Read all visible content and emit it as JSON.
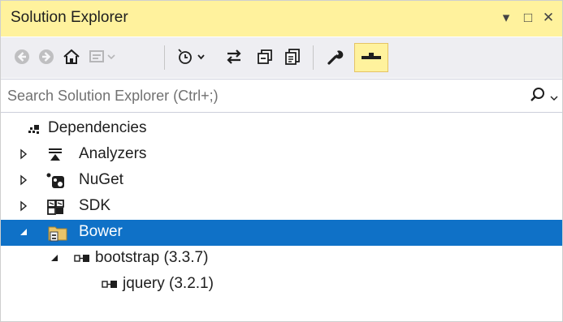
{
  "window": {
    "title": "Solution Explorer",
    "controls": {
      "menu": "▾",
      "maximize": "□",
      "close": "✕"
    }
  },
  "toolbar": {
    "icons": [
      "back-icon",
      "forward-icon",
      "home-icon",
      "switch-views-icon",
      "pending-changes-filter-icon",
      "sync-with-active-document-icon",
      "collapse-all-icon",
      "show-all-files-icon",
      "properties-icon",
      "preview-selected-items-icon"
    ]
  },
  "search": {
    "placeholder": "Search Solution Explorer (Ctrl+;)",
    "icon": "search-icon"
  },
  "tree": {
    "items": [
      {
        "label": "Dependencies",
        "level": 0,
        "expander": "none",
        "icon": "dependencies-icon"
      },
      {
        "label": "Analyzers",
        "level": 1,
        "expander": "collapsed",
        "icon": "analyzers-icon"
      },
      {
        "label": "NuGet",
        "level": 1,
        "expander": "collapsed",
        "icon": "nuget-icon"
      },
      {
        "label": "SDK",
        "level": 1,
        "expander": "collapsed",
        "icon": "sdk-icon"
      },
      {
        "label": "Bower",
        "level": 1,
        "expander": "expanded",
        "icon": "bower-folder-icon",
        "selected": true
      },
      {
        "label": "bootstrap (3.3.7)",
        "level": 2,
        "expander": "expanded",
        "icon": "package-icon"
      },
      {
        "label": "jquery (3.2.1)",
        "level": 3,
        "expander": "none",
        "icon": "package-icon"
      }
    ]
  },
  "colors": {
    "title_bar": "#fff29d",
    "toolbar": "#eeeef2",
    "selection": "#0f71c7",
    "active_toggle": "#fff29d"
  }
}
